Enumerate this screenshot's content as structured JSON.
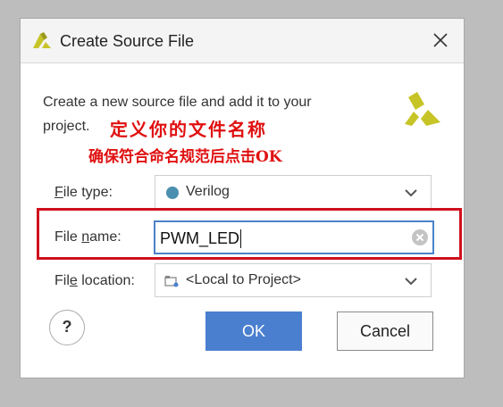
{
  "window": {
    "title": "Create Source File"
  },
  "description": {
    "line1": "Create a new source file and add it to your",
    "line2": "project."
  },
  "annotations": {
    "line1": "定义你的文件名称",
    "line2": "确保符合命名规范后点击OK",
    "highlight_color": "#d0101e"
  },
  "file_type": {
    "label_first": "F",
    "label_rest": "ile type:",
    "value": "Verilog",
    "icon": "verilog-dot-icon"
  },
  "file_name": {
    "label_first": "File ",
    "label_u": "n",
    "label_rest": "ame:",
    "value": "PWM_LED"
  },
  "file_location": {
    "label_first": "Fil",
    "label_u": "e",
    "label_rest": " location:",
    "value": "<Local to Project>",
    "icon": "local-project-icon"
  },
  "buttons": {
    "help": "?",
    "ok": "OK",
    "cancel": "Cancel"
  },
  "colors": {
    "accent": "#4a7fcf",
    "logo": "#c7c427",
    "verilog_dot": "#4b8fb0"
  }
}
